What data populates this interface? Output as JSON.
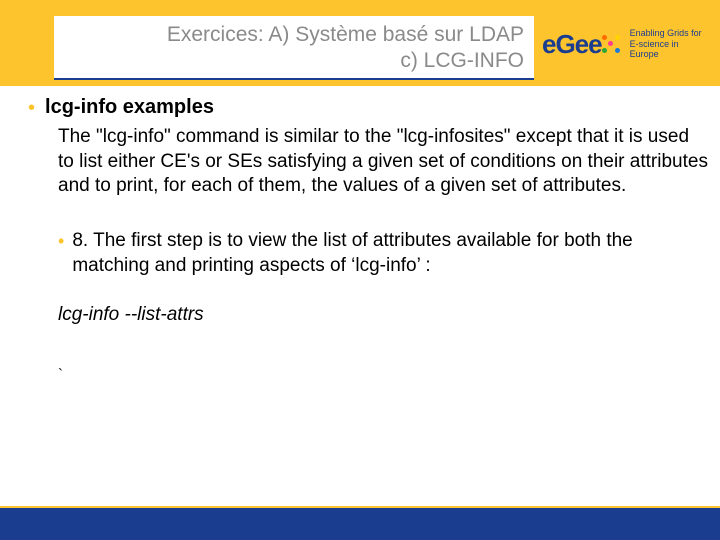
{
  "header": {
    "title_line1": "Exercices: A) Système basé sur LDAP",
    "title_line2": "c) LCG-INFO"
  },
  "logo": {
    "mark": "eGee",
    "tagline_line1": "Enabling Grids for",
    "tagline_line2": "E-science in Europe"
  },
  "body": {
    "heading": "lcg-info examples",
    "paragraph": "The \"lcg-info\" command is similar to the \"lcg-infosites\" except that it is used to list either CE's or SEs satisfying a given set of conditions on their attributes and to print, for each of them, the values of a given set of attributes.",
    "step8": "8. The first step is to view the list of attributes available for both the matching and printing aspects of ‘lcg-info’ :",
    "command": "lcg-info --list-attrs",
    "trailing": "`"
  }
}
